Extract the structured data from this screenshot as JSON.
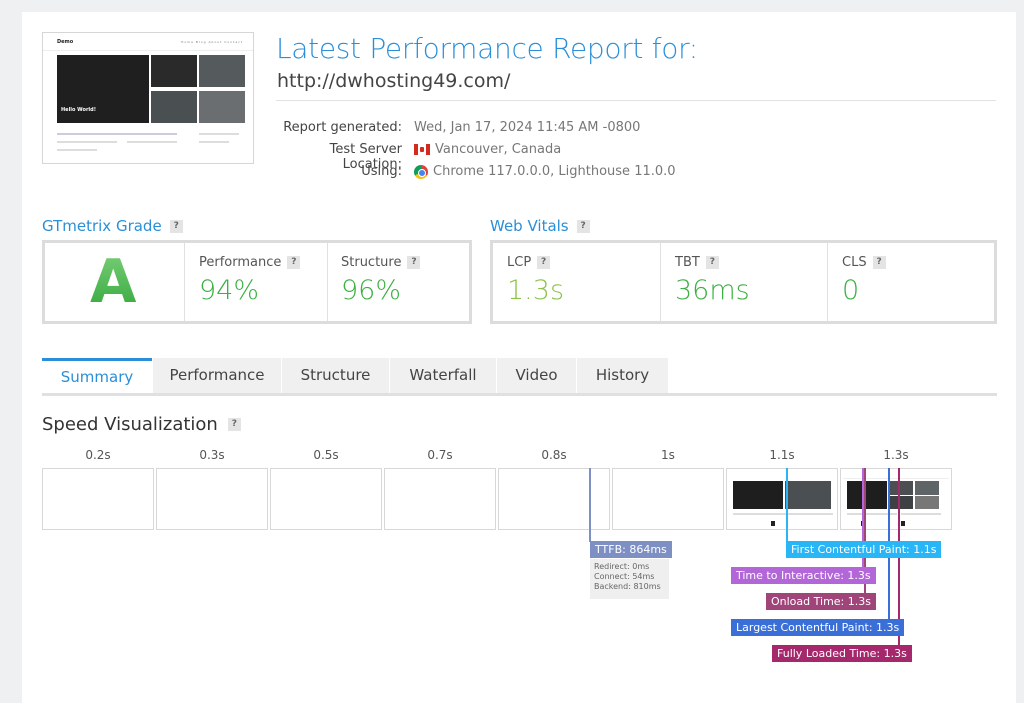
{
  "report": {
    "title": "Latest Performance Report for:",
    "url": "http://dwhosting49.com/",
    "generated_label": "Report generated:",
    "generated_value": "Wed, Jan 17, 2024 11:45 AM -0800",
    "location_label": "Test Server Location:",
    "location_value": "Vancouver, Canada",
    "using_label": "Using:",
    "using_value": "Chrome 117.0.0.0, Lighthouse 11.0.0"
  },
  "thumbnail": {
    "site_name": "Demo",
    "nav": "Home  Blog  About  Contact",
    "hero_text": "Hello World!"
  },
  "grade": {
    "section_title": "GTmetrix Grade",
    "letter": "A",
    "performance_label": "Performance",
    "performance_value": "94%",
    "structure_label": "Structure",
    "structure_value": "96%"
  },
  "vitals": {
    "section_title": "Web Vitals",
    "lcp_label": "LCP",
    "lcp_value": "1.3s",
    "tbt_label": "TBT",
    "tbt_value": "36ms",
    "cls_label": "CLS",
    "cls_value": "0"
  },
  "help_glyph": "?",
  "tabs": [
    "Summary",
    "Performance",
    "Structure",
    "Waterfall",
    "Video",
    "History"
  ],
  "active_tab": "Summary",
  "speed": {
    "title": "Speed Visualization",
    "ticks": [
      "0.2s",
      "0.3s",
      "0.5s",
      "0.7s",
      "0.8s",
      "1s",
      "1.1s",
      "1.3s"
    ],
    "ttfb": "TTFB: 864ms",
    "ttfb_details": [
      "Redirect: 0ms",
      "Connect: 54ms",
      "Backend: 810ms"
    ],
    "markers": {
      "fcp": "First Contentful Paint: 1.1s",
      "tti": "Time to Interactive: 1.3s",
      "onload": "Onload Time: 1.3s",
      "lcp": "Largest Contentful Paint: 1.3s",
      "fully": "Fully Loaded Time: 1.3s"
    }
  },
  "colors": {
    "accent": "#2a8fd8",
    "grade_green": "#3cb043",
    "lcp_green": "#8bc34a",
    "ttfb": "#7e8fc4",
    "fcp": "#29b6f6",
    "tti": "#b266d8",
    "onload": "#a0457a",
    "lcp_marker": "#3a6fd8",
    "fully": "#a4286b"
  }
}
